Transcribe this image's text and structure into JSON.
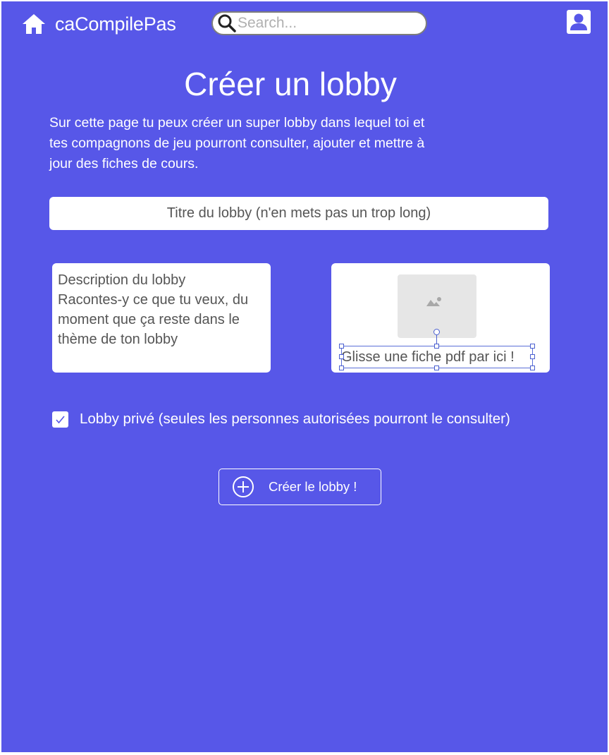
{
  "header": {
    "brand": "caCompilePas",
    "home_icon": "home-icon",
    "search": {
      "placeholder": "Search...",
      "value": "",
      "icon": "search-icon"
    },
    "profile_icon": "user-profile-icon"
  },
  "main": {
    "title": "Créer un lobby",
    "intro_lines": [
      "Sur cette page tu peux créer un super lobby dans lequel toi et",
      "tes compagnons de jeu pourront consulter, ajouter et mettre à",
      "jour des fiches de cours."
    ],
    "title_field": {
      "placeholder": "Titre du lobby (n'en mets pas un trop long)"
    },
    "description_field": {
      "lines": [
        "Description du lobby",
        "Racontes-y ce que tu veux, du",
        "moment que ça reste dans le",
        "thème de ton lobby"
      ]
    },
    "dropzone": {
      "label": "Glisse une fiche pdf par ici !",
      "icon": "image-placeholder-icon"
    },
    "private_option": {
      "checked": true,
      "label": "Lobby privé (seules les personnes autorisées pourront le consulter)"
    },
    "create_button": {
      "label": "Créer le lobby !",
      "icon": "plus-circle-icon"
    }
  },
  "colors": {
    "background": "#5757e8",
    "text_light": "#ffffff",
    "field_text": "#555555",
    "selection": "#4a5fd0"
  }
}
